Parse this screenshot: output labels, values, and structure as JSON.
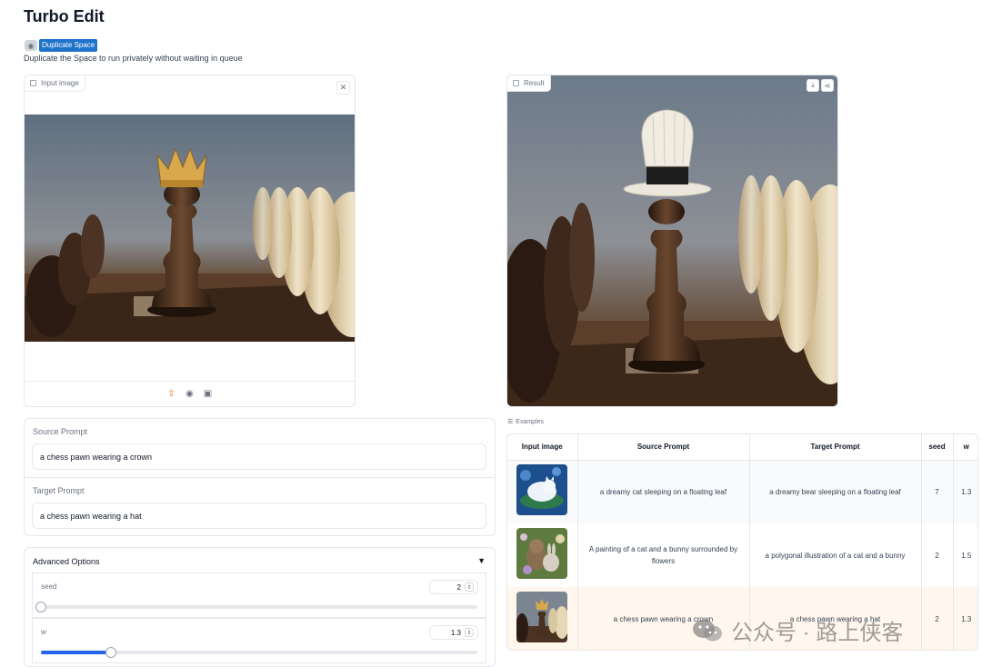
{
  "app": {
    "title": "Turbo Edit",
    "duplicate_label": "Duplicate Space",
    "duplicate_text": "Duplicate the Space to run privately without waiting in queue"
  },
  "input_panel": {
    "label": "Input image",
    "clear_icon": "close-icon",
    "sources": [
      "upload-icon",
      "webcam-icon",
      "clipboard-icon"
    ]
  },
  "result_panel": {
    "label": "Result",
    "actions": [
      "download-icon",
      "share-icon"
    ]
  },
  "prompts": {
    "source_label": "Source Prompt",
    "source_value": "a chess pawn wearing a crown",
    "target_label": "Target Prompt",
    "target_value": "a chess pawn wearing a hat"
  },
  "advanced": {
    "title": "Advanced Options",
    "caret": "▼",
    "seed": {
      "label": "seed",
      "value": "2",
      "min": 0,
      "max": 100,
      "level": 0.0
    },
    "w": {
      "label": "w",
      "value": "1.3",
      "level": 0.16
    }
  },
  "examples": {
    "label": "Examples",
    "headers": [
      "Input image",
      "Source Prompt",
      "Target Prompt",
      "seed",
      "w"
    ],
    "rows": [
      {
        "image": "cat-on-leaf-thumbnail",
        "source": "a dreamy cat sleeping on a floating leaf",
        "target": "a dreamy bear sleeping on a floating leaf",
        "seed": "7",
        "w": "1.3"
      },
      {
        "image": "cat-bunny-painting-thumbnail",
        "source": "A painting of a cat and a bunny surrounded by flowers",
        "target": "a polygonal illustration of a cat and a bunny",
        "seed": "2",
        "w": "1.5"
      },
      {
        "image": "chess-pawn-thumbnail",
        "source": "a chess pawn wearing a crown",
        "target": "a chess pawn wearing a hat",
        "seed": "2",
        "w": "1.3"
      }
    ]
  },
  "watermark": {
    "text": "公众号 · 路上侠客"
  },
  "colors": {
    "accent": "#1f73c9",
    "slider": "#2563eb",
    "highlight_row": "#fff7ed",
    "upload_active": "#f97316"
  }
}
